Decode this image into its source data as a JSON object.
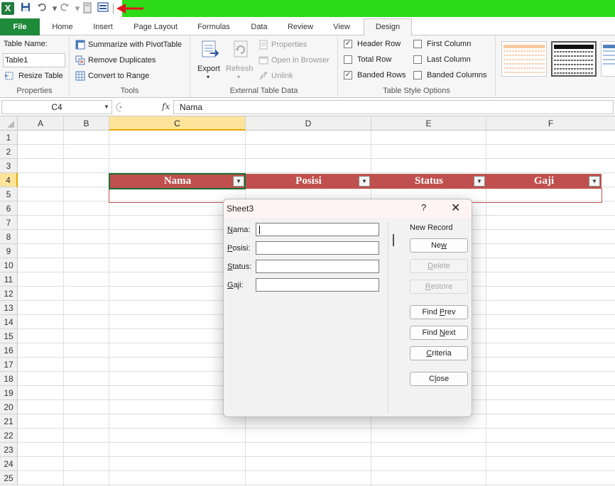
{
  "qat": {
    "excel_logo": "X",
    "icons": [
      "excel-icon",
      "save-icon",
      "undo-icon",
      "redo-icon",
      "calculator-icon",
      "form-icon",
      "arrow-icon"
    ],
    "accent": "#2ddb17",
    "arrow_color": "#e0141e"
  },
  "tabs": [
    "File",
    "Home",
    "Insert",
    "Page Layout",
    "Formulas",
    "Data",
    "Review",
    "View",
    "Design"
  ],
  "ribbon": {
    "properties": {
      "label": "Properties",
      "table_name_label": "Table Name:",
      "table_name_value": "Table1",
      "resize_label": "Resize Table"
    },
    "tools": {
      "label": "Tools",
      "summarize": "Summarize with PivotTable",
      "remove_duplicates": "Remove Duplicates",
      "convert": "Convert to Range"
    },
    "external": {
      "label": "External Table Data",
      "export": "Export",
      "refresh": "Refresh",
      "properties": "Properties",
      "open_browser": "Open in Browser",
      "unlink": "Unlink"
    },
    "style_options": {
      "label": "Table Style Options",
      "header_row": "Header Row",
      "total_row": "Total Row",
      "banded_rows": "Banded Rows",
      "first_column": "First Column",
      "last_column": "Last Column",
      "banded_columns": "Banded Columns",
      "header_row_checked": true,
      "total_row_checked": false,
      "banded_rows_checked": true,
      "first_column_checked": false,
      "last_column_checked": false,
      "banded_columns_checked": false
    }
  },
  "formula_bar": {
    "namebox": "C4",
    "fx": "fx",
    "value": "Nama"
  },
  "grid": {
    "columns": [
      "A",
      "B",
      "C",
      "D",
      "E",
      "F"
    ],
    "rows": [
      "1",
      "2",
      "3",
      "4",
      "5",
      "6",
      "7",
      "8",
      "9",
      "10",
      "11",
      "12",
      "13",
      "14",
      "15",
      "16",
      "17",
      "18",
      "19",
      "20",
      "21",
      "22",
      "23",
      "24",
      "25"
    ],
    "table_headers": [
      "Nama",
      "Posisi",
      "Status",
      "Gaji"
    ],
    "header_color": "#c0504d"
  },
  "dialog": {
    "title": "Sheet3",
    "help": "?",
    "close_x": "✕",
    "fields": [
      {
        "label": "Nama:",
        "value": ""
      },
      {
        "label": "Posisi:",
        "value": ""
      },
      {
        "label": "Status:",
        "value": ""
      },
      {
        "label": "Gaji:",
        "value": ""
      }
    ],
    "record_label": "New Record",
    "buttons": {
      "new": "New",
      "delete": "Delete",
      "restore": "Restore",
      "find_prev": "Find Prev",
      "find_next": "Find Next",
      "criteria": "Criteria",
      "close": "Close"
    }
  }
}
